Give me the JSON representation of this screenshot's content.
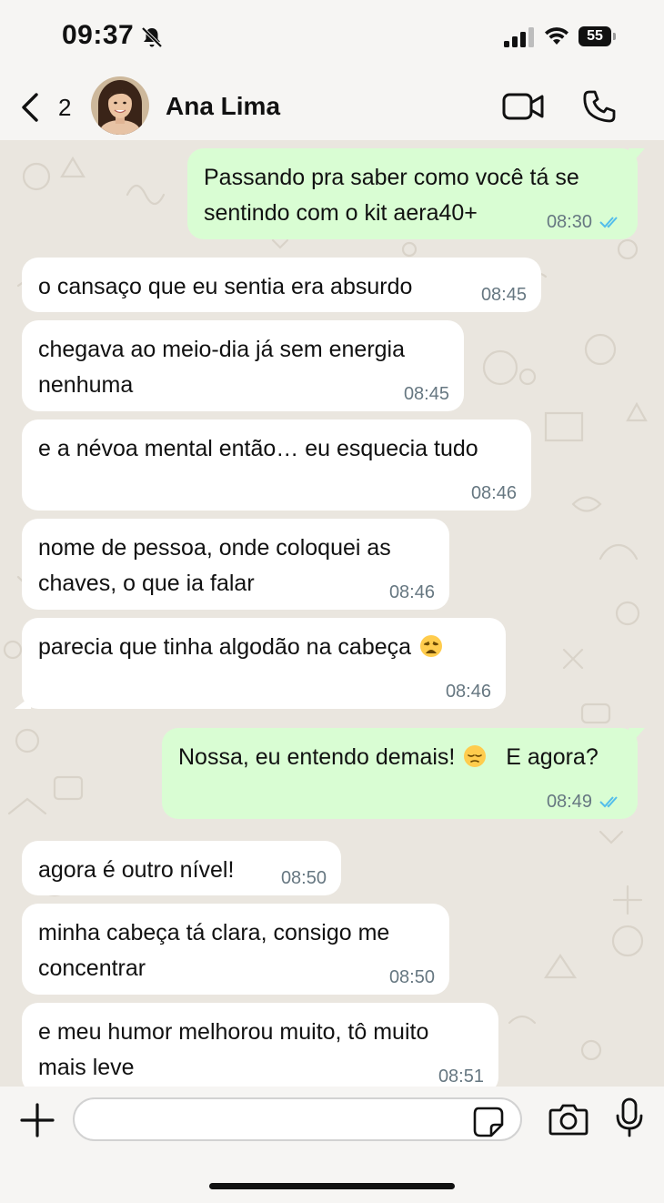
{
  "status_bar": {
    "time": "09:37",
    "battery_level": "55",
    "icons": [
      "bell-slash-icon",
      "cellular-signal-icon",
      "wifi-icon",
      "battery-icon"
    ]
  },
  "header": {
    "back_count": "2",
    "contact_name": "Ana Lima",
    "icons": [
      "chevron-left-icon",
      "video-call-icon",
      "phone-call-icon"
    ]
  },
  "messages": [
    {
      "direction": "outgoing",
      "text": "Passando pra saber como você tá se sentindo com o kit aera40+",
      "time": "08:30",
      "status": "read"
    },
    {
      "direction": "incoming",
      "text": "o cansaço que eu sentia era absurdo",
      "time": "08:45"
    },
    {
      "direction": "incoming",
      "text": "chegava ao meio-dia já sem energia nenhuma",
      "time": "08:45"
    },
    {
      "direction": "incoming",
      "text": "e a névoa mental então… eu esquecia tudo",
      "time": "08:46"
    },
    {
      "direction": "incoming",
      "text": "nome de pessoa, onde coloquei as chaves, o que ia falar",
      "time": "08:46"
    },
    {
      "direction": "incoming",
      "text": "parecia que tinha algodão na cabeça",
      "emoji": "weary-face-emoji",
      "time": "08:46"
    },
    {
      "direction": "outgoing",
      "text": "Nossa, eu entendo demais!",
      "emoji": "pensive-face-emoji",
      "text_after": "E agora?",
      "time": "08:49",
      "status": "read"
    },
    {
      "direction": "incoming",
      "text": "agora é outro nível!",
      "time": "08:50"
    },
    {
      "direction": "incoming",
      "text": "minha cabeça tá clara, consigo me concentrar",
      "time": "08:50"
    },
    {
      "direction": "incoming",
      "text": "e meu humor melhorou muito, tô muito mais leve",
      "time": "08:51"
    }
  ],
  "input_bar": {
    "placeholder": "",
    "icons": [
      "plus-icon",
      "sticker-icon",
      "camera-icon",
      "microphone-icon"
    ]
  },
  "colors": {
    "outgoing_bubble": "#d9fdd3",
    "incoming_bubble": "#ffffff",
    "chat_background": "#eae6df",
    "read_ticks": "#53bdeb",
    "meta_text": "#667781"
  }
}
